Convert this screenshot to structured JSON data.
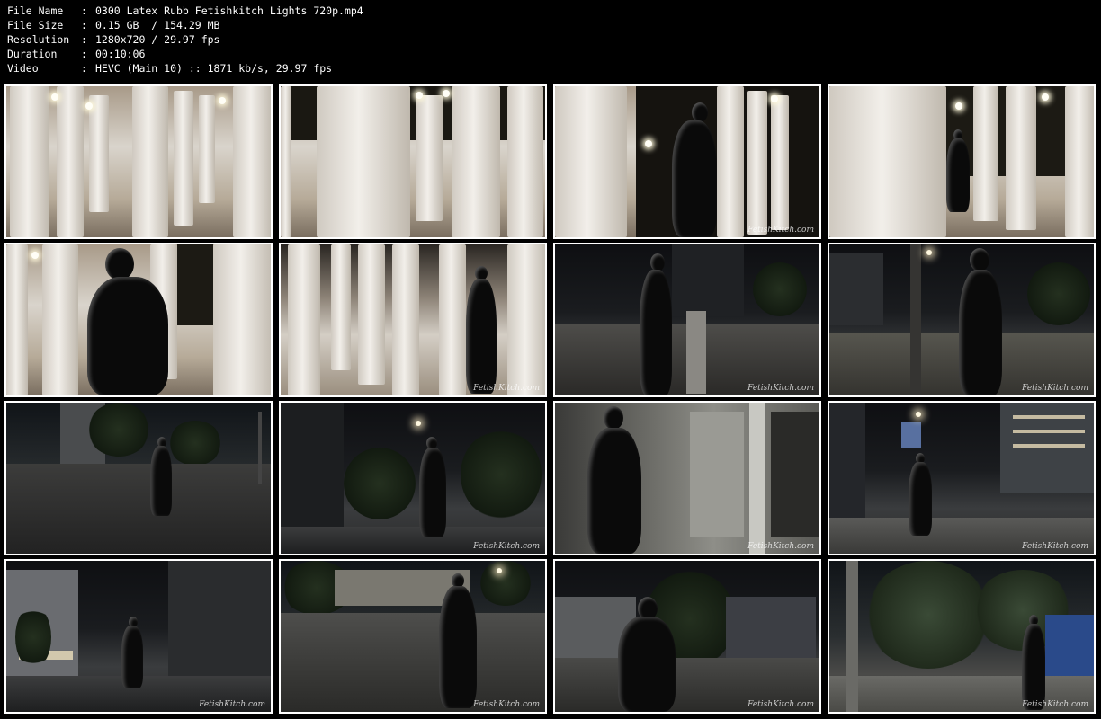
{
  "file_info": [
    {
      "key": "File Name",
      "sep": ":",
      "value": "0300 Latex Rubb Fetishkitch Lights 720p.mp4"
    },
    {
      "key": "File Size",
      "sep": ":",
      "value": "0.15 GB  / 154.29 MB"
    },
    {
      "key": "Resolution",
      "sep": ":",
      "value": "1280x720 / 29.97 fps"
    },
    {
      "key": "Duration",
      "sep": ":",
      "value": "00:10:06"
    },
    {
      "key": "Video",
      "sep": ":",
      "value": "HEVC (Main 10) :: 1871 kb/s, 29.97 fps"
    }
  ],
  "thumbnails": {
    "watermark": "FetishKitch.com",
    "scenes": [
      {
        "scene": "lamp-columns-wide",
        "watermark_visible": false
      },
      {
        "scene": "lamp-columns-closeup",
        "watermark_visible": false
      },
      {
        "scene": "figure-at-columns",
        "watermark_visible": true
      },
      {
        "scene": "figure-behind-column",
        "watermark_visible": false
      },
      {
        "scene": "figure-among-columns",
        "watermark_visible": false
      },
      {
        "scene": "figure-walking-columns",
        "watermark_visible": true
      },
      {
        "scene": "figure-plaza-night",
        "watermark_visible": true
      },
      {
        "scene": "figure-street-pole",
        "watermark_visible": true
      },
      {
        "scene": "figure-street-wide",
        "watermark_visible": false
      },
      {
        "scene": "figure-street-night",
        "watermark_visible": true
      },
      {
        "scene": "figure-storefront",
        "watermark_visible": true
      },
      {
        "scene": "figure-street-lights",
        "watermark_visible": true
      },
      {
        "scene": "figure-building-night",
        "watermark_visible": true
      },
      {
        "scene": "figure-sidewalk-front",
        "watermark_visible": true
      },
      {
        "scene": "figure-trees-closeup",
        "watermark_visible": true
      },
      {
        "scene": "figure-palms",
        "watermark_visible": true
      }
    ]
  }
}
